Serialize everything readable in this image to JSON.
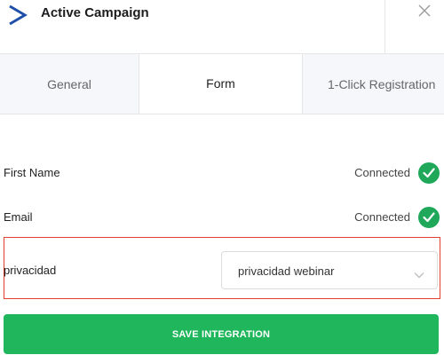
{
  "header": {
    "title": "Active Campaign",
    "logo_icon": "active-campaign-chevron-logo",
    "close_icon": "close-icon"
  },
  "tabs": [
    {
      "label": "General",
      "active": false
    },
    {
      "label": "Form",
      "active": true
    },
    {
      "label": "1-Click Registration",
      "active": false
    }
  ],
  "fields": [
    {
      "label": "First Name",
      "status": "Connected"
    },
    {
      "label": "Email",
      "status": "Connected"
    }
  ],
  "privacy": {
    "label": "privacidad",
    "selected": "privacidad webinar"
  },
  "save_button": {
    "label": "SAVE INTEGRATION"
  },
  "colors": {
    "brand_logo": "#1f4fa8",
    "connected_check": "#1fa859",
    "save_button": "#1fb65c",
    "highlight_border": "#e0422f"
  }
}
